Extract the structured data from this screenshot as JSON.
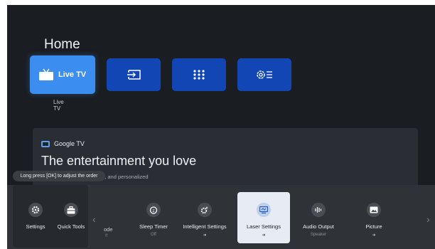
{
  "home": {
    "title": "Home"
  },
  "apps_row": {
    "live_tv": {
      "label": "Live TV",
      "caption": "Live TV",
      "icon": "tv-icon"
    },
    "input": {
      "icon": "input-icon"
    },
    "apps": {
      "icon": "apps-grid-icon"
    },
    "settings": {
      "icon": "settings-list-icon"
    }
  },
  "google_tv": {
    "brand": "Google TV",
    "headline": "The entertainment you love",
    "description": "get apps, Google Assistant, and personalized"
  },
  "tooltip": {
    "text": "Long press [OK] to adjust the order"
  },
  "quick_panel": {
    "pinned": [
      {
        "label": "Settings",
        "icon": "gear-icon"
      },
      {
        "label": "Quick Tools",
        "icon": "toolbox-icon"
      }
    ],
    "partial_label": "ode",
    "partial_sub": "ff",
    "items": [
      {
        "label": "Sleep Timer",
        "sub": "Off",
        "icon": "timer-icon"
      },
      {
        "label": "Intelligent Settings",
        "sub": "➜",
        "icon": "smart-settings-icon"
      },
      {
        "label": "Laser Settings",
        "sub": "➜",
        "icon": "laser-icon"
      },
      {
        "label": "Audio Output",
        "sub": "Speaker",
        "icon": "audio-bars-icon"
      },
      {
        "label": "Picture",
        "sub": "➜",
        "icon": "picture-icon"
      }
    ],
    "left_arrow": "‹",
    "right_arrow": "›"
  },
  "colors": {
    "accent": "#3c8df0",
    "tile": "#1346b5",
    "background": "#1a1d22"
  }
}
